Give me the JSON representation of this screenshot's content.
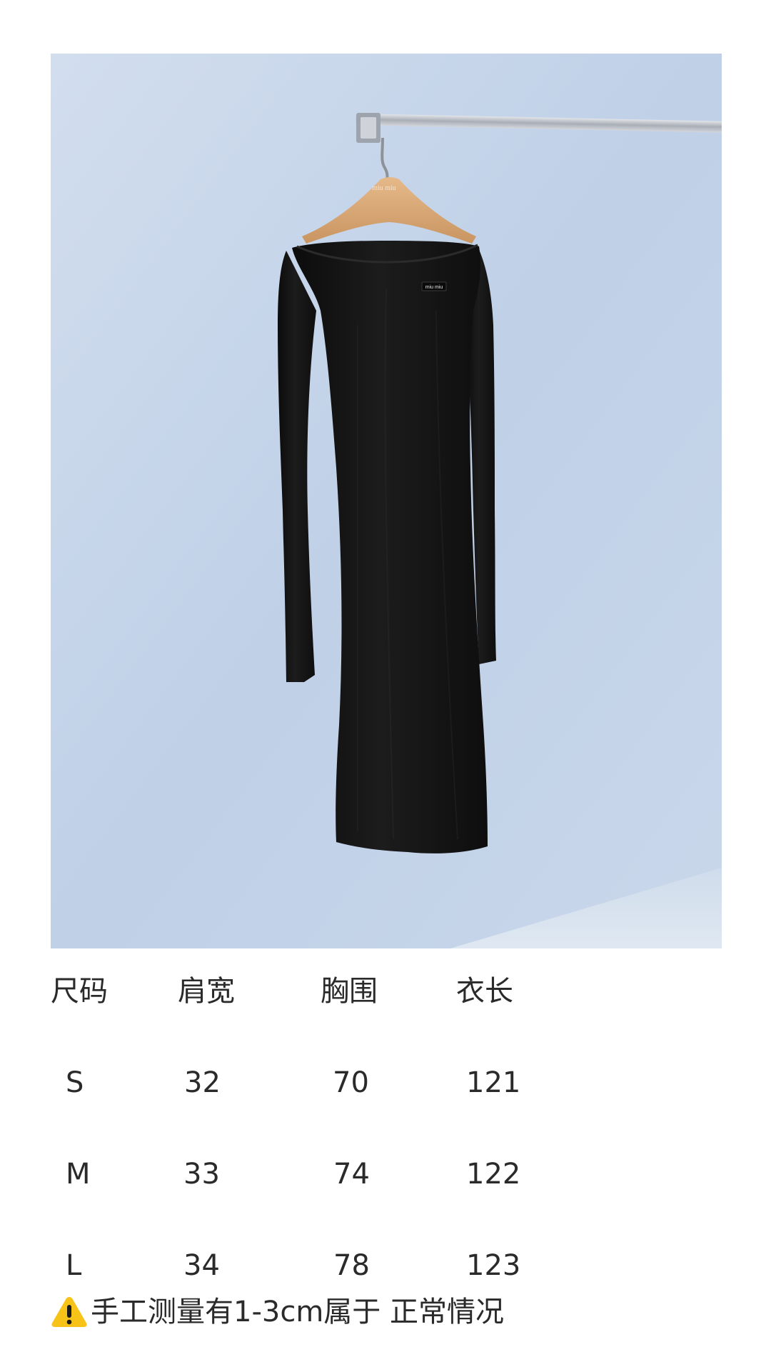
{
  "photo": {
    "alt": "",
    "hanger_brand": "miu miu",
    "label_brand": "miu miu",
    "colors": {
      "wall": "#c4d4e9",
      "dress": "#151515",
      "hanger": "#d8a878",
      "rail": "#b9bec6"
    }
  },
  "size_table": {
    "headers": [
      "尺码",
      "肩宽",
      "胸围",
      "衣长"
    ],
    "rows": [
      [
        "S",
        "32",
        "70",
        "121"
      ],
      [
        "M",
        "33",
        "74",
        "122"
      ],
      [
        "L",
        "34",
        "78",
        "123"
      ]
    ]
  },
  "note": {
    "icon": "warning-icon",
    "text": "手工测量有1-3cm属于 正常情况"
  }
}
